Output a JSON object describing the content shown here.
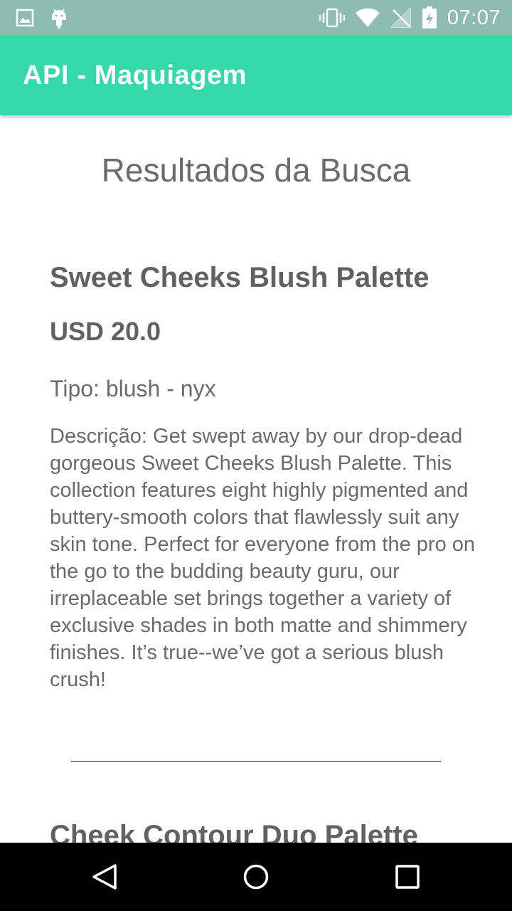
{
  "status_bar": {
    "time": "07:07",
    "left_icons": [
      "image-notification-icon",
      "android-notification-icon"
    ],
    "right_icons": [
      "vibrate-icon",
      "wifi-icon",
      "no-signal-icon",
      "battery-icon"
    ]
  },
  "app_bar": {
    "title": "API - Maquiagem"
  },
  "page": {
    "heading": "Resultados da Busca"
  },
  "products": [
    {
      "name": "Sweet Cheeks Blush Palette",
      "price": "USD 20.0",
      "type": "Tipo: blush - nyx",
      "description": "Descrição: Get swept away by our drop-dead gorgeous Sweet Cheeks Blush Palette. This collection features eight highly pigmented and buttery-smooth colors that flawlessly suit any skin tone. Perfect for everyone from the pro on the go to the budding beauty guru, our irreplaceable set brings together a variety of exclusive shades in both matte and shimmery finishes. It’s true--we’ve got a serious blush crush!"
    },
    {
      "name": "Cheek Contour Duo Palette"
    }
  ],
  "nav_bar": {
    "buttons": [
      "back-icon",
      "home-icon",
      "recents-icon"
    ]
  },
  "colors": {
    "status_bar": "#8fbcb0",
    "app_bar": "#35d8a8",
    "text_dark": "#616161",
    "text_body": "#6b6b6b",
    "nav_bar": "#000000"
  }
}
